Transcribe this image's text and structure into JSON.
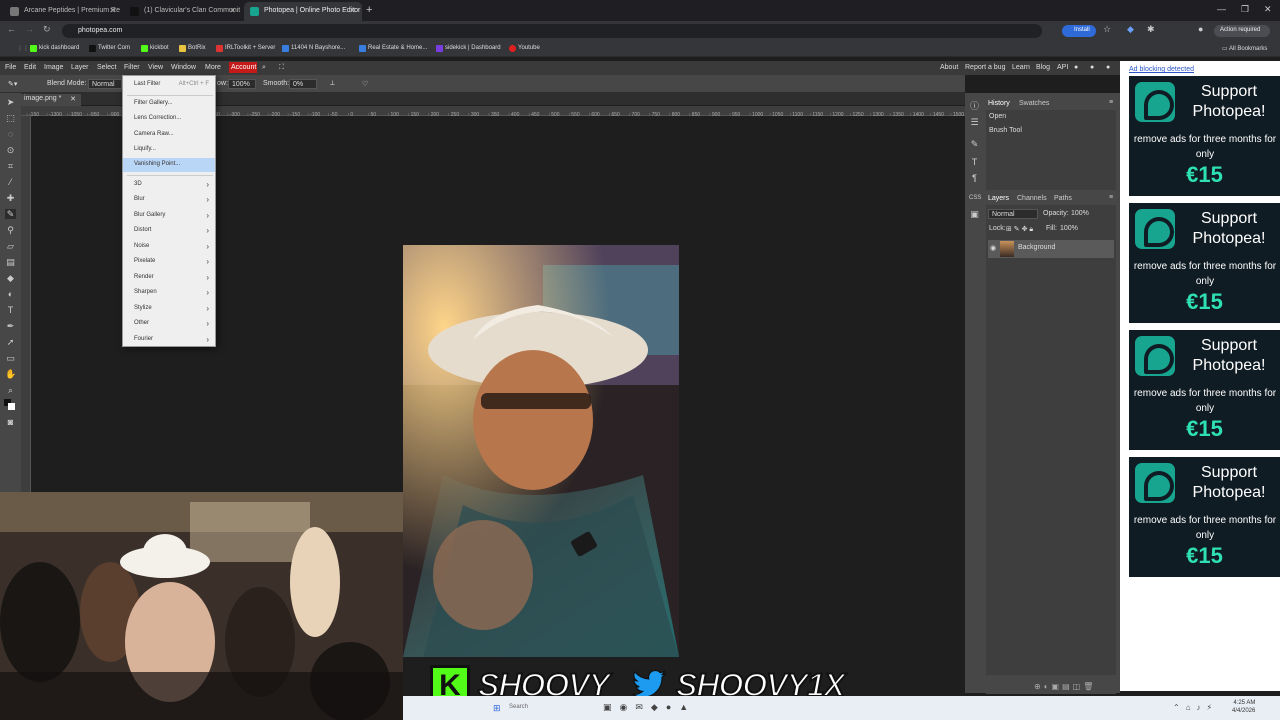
{
  "browser": {
    "tabs": [
      {
        "title": "Arcane Peptides | Premium Re",
        "active": false
      },
      {
        "title": "(1) Clavicular's Clan Communit",
        "active": false
      },
      {
        "title": "Photopea | Online Photo Editor",
        "active": true
      }
    ],
    "url": "photopea.com",
    "install_label": "Install",
    "action_required_label": "Action required",
    "bookmarks": [
      "kick dashboard",
      "Twitter Com",
      "kickbot",
      "BotRix",
      "IRLToolkit + Server",
      "11404 N Bayshore...",
      "Real Estate & Home...",
      "sidekick | Dashboard",
      "Youtube"
    ],
    "all_bookmarks_label": "All Bookmarks"
  },
  "menubar": {
    "items": [
      "File",
      "Edit",
      "Image",
      "Layer",
      "Select",
      "Filter",
      "View",
      "Window",
      "More"
    ],
    "account_label": "Account",
    "right_links": [
      "About",
      "Report a bug",
      "Learn",
      "Blog",
      "API"
    ]
  },
  "options": {
    "blend_mode_label": "Blend Mode:",
    "blend_mode_value": "Normal",
    "flow_label": "ow:",
    "flow_value": "100%",
    "smooth_label": "Smooth:",
    "smooth_value": "0%"
  },
  "document": {
    "tab_name": "image.png *",
    "ruler_labels": [
      "-150",
      "-1300",
      "-1050",
      "-950",
      "-900",
      "-550",
      "-500",
      "-450",
      "-400",
      "-350",
      "-300",
      "-250",
      "-200",
      "-150",
      "-100",
      "-50",
      "0",
      "50",
      "100",
      "150",
      "200",
      "250",
      "300",
      "350",
      "400",
      "450",
      "500",
      "550",
      "600",
      "650",
      "700",
      "750",
      "800",
      "850",
      "900",
      "950",
      "1000",
      "1050",
      "1100",
      "1150",
      "1200",
      "1250",
      "1300",
      "1350",
      "1400",
      "1450",
      "1500"
    ]
  },
  "filter_menu": {
    "last_filter": {
      "label": "Last Filter",
      "shortcut": "Alt+Ctrl + F"
    },
    "top_items": [
      "Filter Gallery...",
      "Lens Correction...",
      "Camera Raw...",
      "Liquify...",
      "Vanishing Point..."
    ],
    "highlighted": "Vanishing Point...",
    "submenus": [
      "3D",
      "Blur",
      "Blur Gallery",
      "Distort",
      "Noise",
      "Pixelate",
      "Render",
      "Sharpen",
      "Stylize",
      "Other",
      "Fourier"
    ]
  },
  "panels": {
    "history_tabs": [
      "History",
      "Swatches"
    ],
    "history_items": [
      "Open",
      "Brush Tool"
    ],
    "layer_tabs": [
      "Layers",
      "Channels",
      "Paths"
    ],
    "layer_blend": "Normal",
    "opacity_label": "Opacity:",
    "opacity_value": "100%",
    "lock_label": "Lock:",
    "fill_label": "Fill:",
    "fill_value": "100%",
    "layer_name": "Background"
  },
  "ads": {
    "blocking_notice": "Ad blocking detected",
    "headline": "Support Photopea!",
    "subtitle": "remove ads for three months for only",
    "price": "€15",
    "count": 4
  },
  "overlay": {
    "kick_letter": "K",
    "kick_handle": "SHOOVY",
    "twitter_handle": "SHOOVY1X"
  },
  "taskbar": {
    "time": "4:25 AM",
    "date": "4/4/2026",
    "search_placeholder": "Search"
  },
  "colors": {
    "accent_red": "#c41a1a",
    "install_blue": "#2f6ad9",
    "ad_bg": "#101c24",
    "ad_price": "#2ee0b4",
    "kick_green": "#53fc18"
  }
}
